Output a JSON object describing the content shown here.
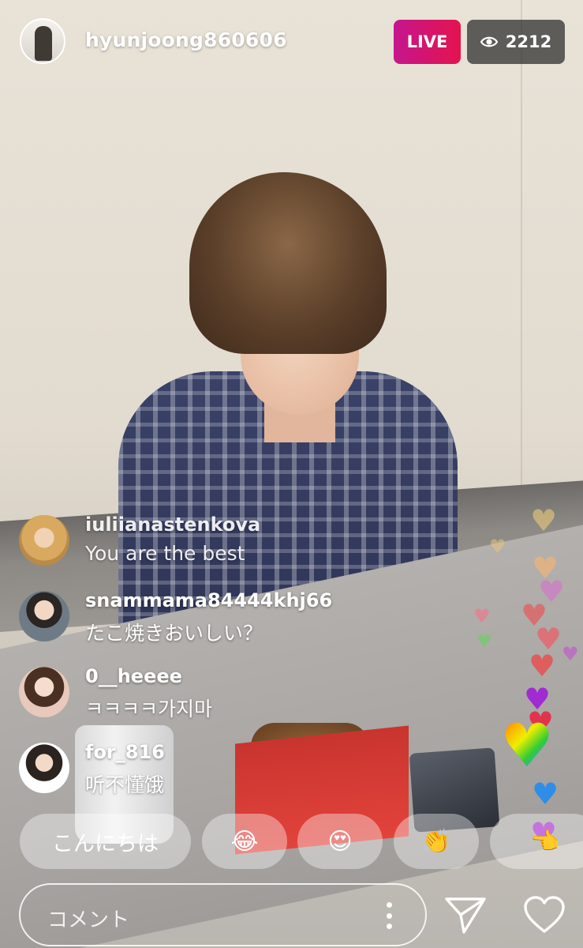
{
  "header": {
    "username": "hyunjoong860606",
    "live_label": "LIVE",
    "viewer_count": "2212",
    "viewer_icon": "eye-icon"
  },
  "comments": [
    {
      "username": "iuliianastenkova",
      "text": "You are the best"
    },
    {
      "username": "snammama84444khj66",
      "text": "たこ焼きおいしい？"
    },
    {
      "username": "0__heeee",
      "text": "ㅋㅋㅋㅋ가지마"
    },
    {
      "username": "for_816",
      "text": "听不懂饿"
    }
  ],
  "quick_replies": [
    {
      "label": "こんにちは"
    },
    {
      "label": "😂",
      "icon": "laughing-face-emoji"
    },
    {
      "label": "😍",
      "icon": "heart-eyes-emoji"
    },
    {
      "label": "👏",
      "icon": "clapping-hands-emoji"
    },
    {
      "label": "👈",
      "icon": "pointing-hand-emoji"
    }
  ],
  "footer": {
    "comment_placeholder": "コメント",
    "more_icon": "more-options-icon",
    "send_icon": "send-icon",
    "like_icon": "heart-icon"
  },
  "colors": {
    "live_gradient_start": "#c5168e",
    "live_gradient_end": "#e5134e",
    "viewer_badge_bg": "#282828"
  }
}
